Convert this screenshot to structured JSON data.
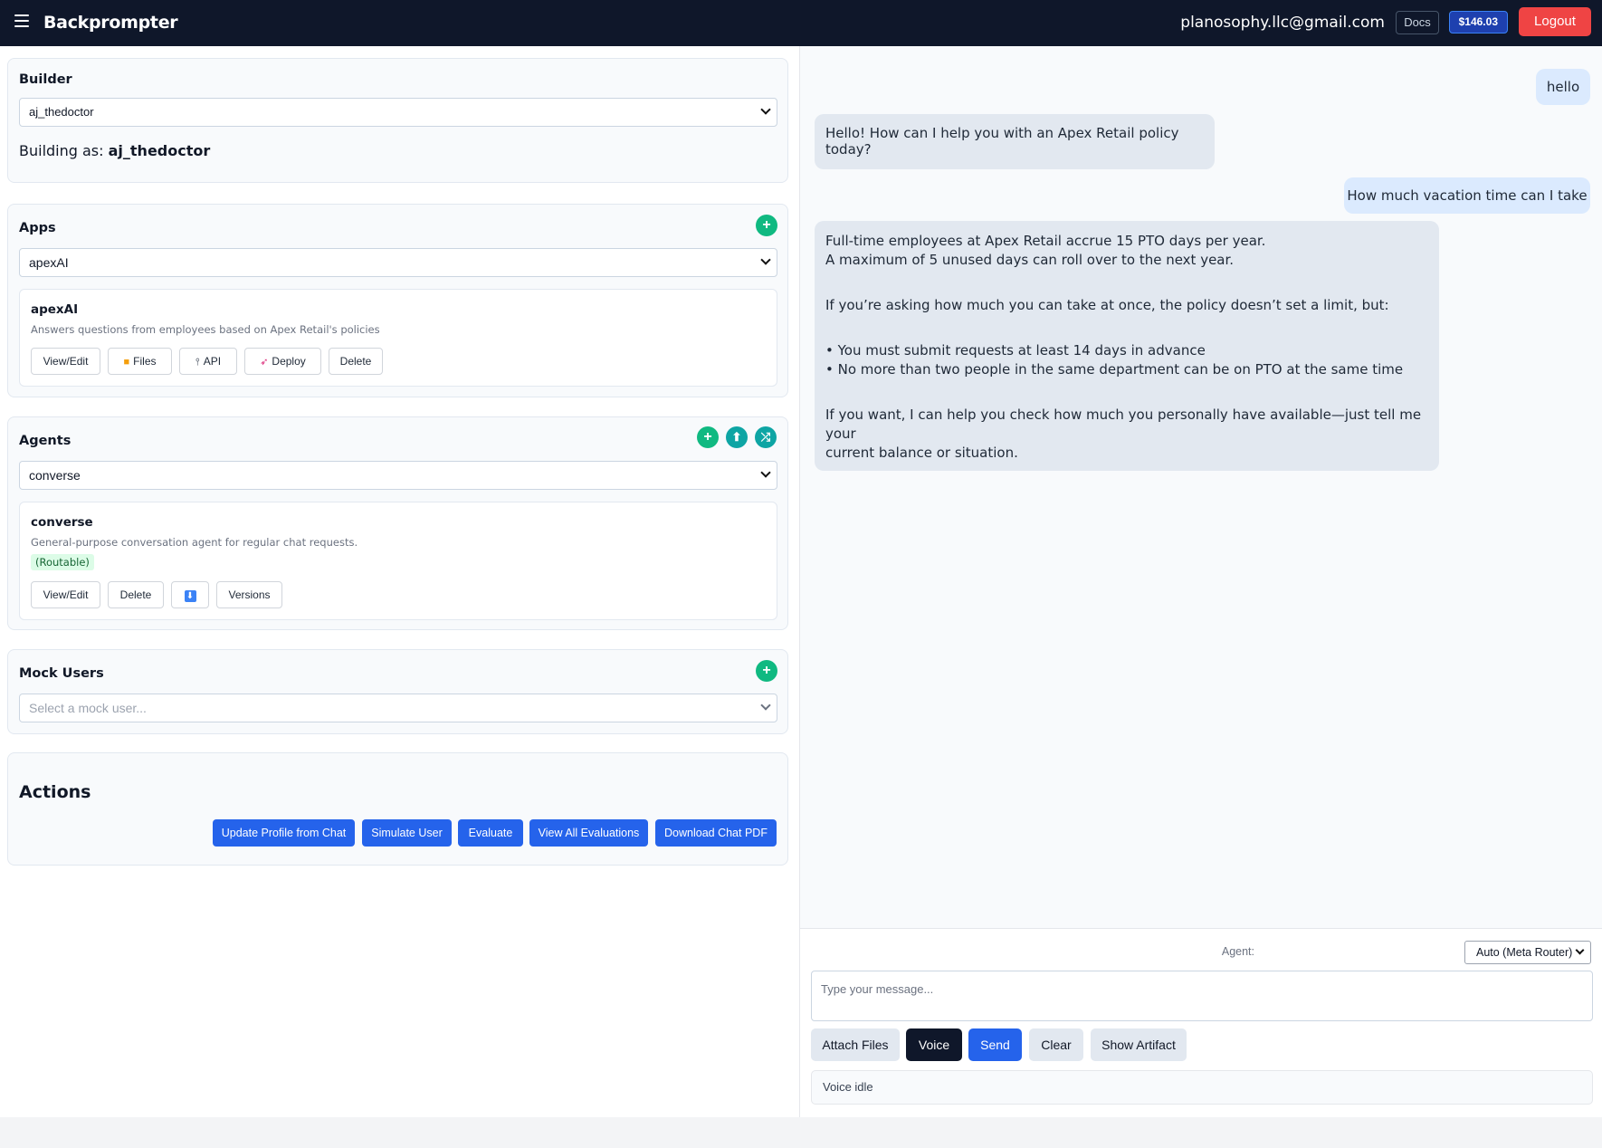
{
  "topbar": {
    "brand": "Backprompter",
    "user_email": "planosophy.llc@gmail.com",
    "docs_label": "Docs",
    "balance": "$146.03",
    "logout_label": "Logout"
  },
  "builder": {
    "title": "Builder",
    "selected": "aj_thedoctor",
    "building_as_label": "Building as:",
    "building_as_value": "aj_thedoctor"
  },
  "apps": {
    "title": "Apps",
    "selected": "apexAI",
    "card": {
      "name": "apexAI",
      "description": "Answers questions from employees based on Apex Retail's policies",
      "buttons": {
        "view_edit": "View/Edit",
        "files": "Files",
        "api": "API",
        "deploy": "Deploy",
        "delete": "Delete"
      }
    }
  },
  "agents": {
    "title": "Agents",
    "selected": "converse",
    "card": {
      "name": "converse",
      "description": "General-purpose conversation agent for regular chat requests.",
      "badge": "(Routable)",
      "buttons": {
        "view_edit": "View/Edit",
        "delete": "Delete",
        "versions": "Versions"
      }
    }
  },
  "mock_users": {
    "title": "Mock Users",
    "placeholder": "Select a mock user..."
  },
  "actions": {
    "title": "Actions",
    "buttons": {
      "update_profile": "Update Profile from Chat",
      "simulate_user": "Simulate User",
      "evaluate": "Evaluate",
      "view_all": "View All Evaluations",
      "download_pdf": "Download Chat PDF"
    }
  },
  "chat": {
    "messages": [
      {
        "role": "user",
        "text": "hello"
      },
      {
        "role": "assistant",
        "text": "Hello! How can I help you with an Apex Retail policy today?"
      },
      {
        "role": "user",
        "text": "How much vacation time can I take"
      },
      {
        "role": "assistant",
        "lines": [
          "Full-time employees at Apex Retail accrue 15 PTO days per year.",
          "A maximum of 5 unused days can roll over to the next year.",
          "",
          "If you’re asking how much you can take at once, the policy doesn’t set a limit, but:",
          "",
          "• You must submit requests at least 14 days in advance",
          "• No more than two people in the same department can be on PTO at the same time",
          "",
          "If you want, I can help you check how much you personally have available—just tell me your",
          "current balance or situation."
        ]
      }
    ]
  },
  "composer": {
    "agent_label": "Agent:",
    "agent_selected": "Auto (Meta Router)",
    "placeholder": "Type your message...",
    "buttons": {
      "attach": "Attach Files",
      "voice": "Voice",
      "send": "Send",
      "clear": "Clear",
      "artifact": "Show Artifact"
    },
    "voice_status": "Voice idle"
  },
  "colors": {
    "topbar": "#0f172a",
    "primary": "#2563eb",
    "danger": "#ef4444",
    "success": "#10b981"
  }
}
